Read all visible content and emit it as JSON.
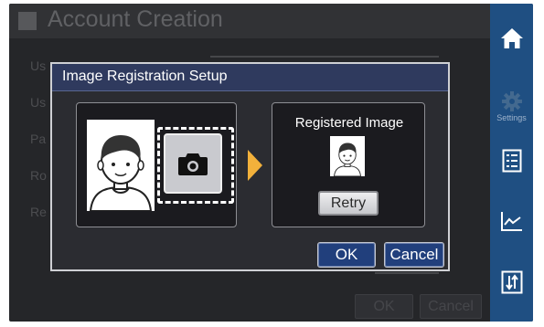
{
  "background": {
    "title": "Account Creation",
    "field_labels": [
      "Us",
      "Us",
      "Pa",
      "Ro",
      "Re"
    ],
    "ok_label": "OK",
    "cancel_label": "Cancel"
  },
  "sidebar": {
    "items": [
      {
        "icon": "home-icon",
        "label": ""
      },
      {
        "icon": "gear-icon",
        "label": "Settings"
      },
      {
        "icon": "checklist-icon",
        "label": ""
      },
      {
        "icon": "line-chart-icon",
        "label": ""
      },
      {
        "icon": "transfer-icon",
        "label": ""
      }
    ]
  },
  "dialog": {
    "title": "Image Registration Setup",
    "registered_title": "Registered Image",
    "retry_label": "Retry",
    "ok_label": "OK",
    "cancel_label": "Cancel"
  },
  "colors": {
    "sidebar": "#1f4f82",
    "dialog_header": "#2f3a5e",
    "accent_arrow": "#f2b13b",
    "primary_button": "#213f7c"
  }
}
